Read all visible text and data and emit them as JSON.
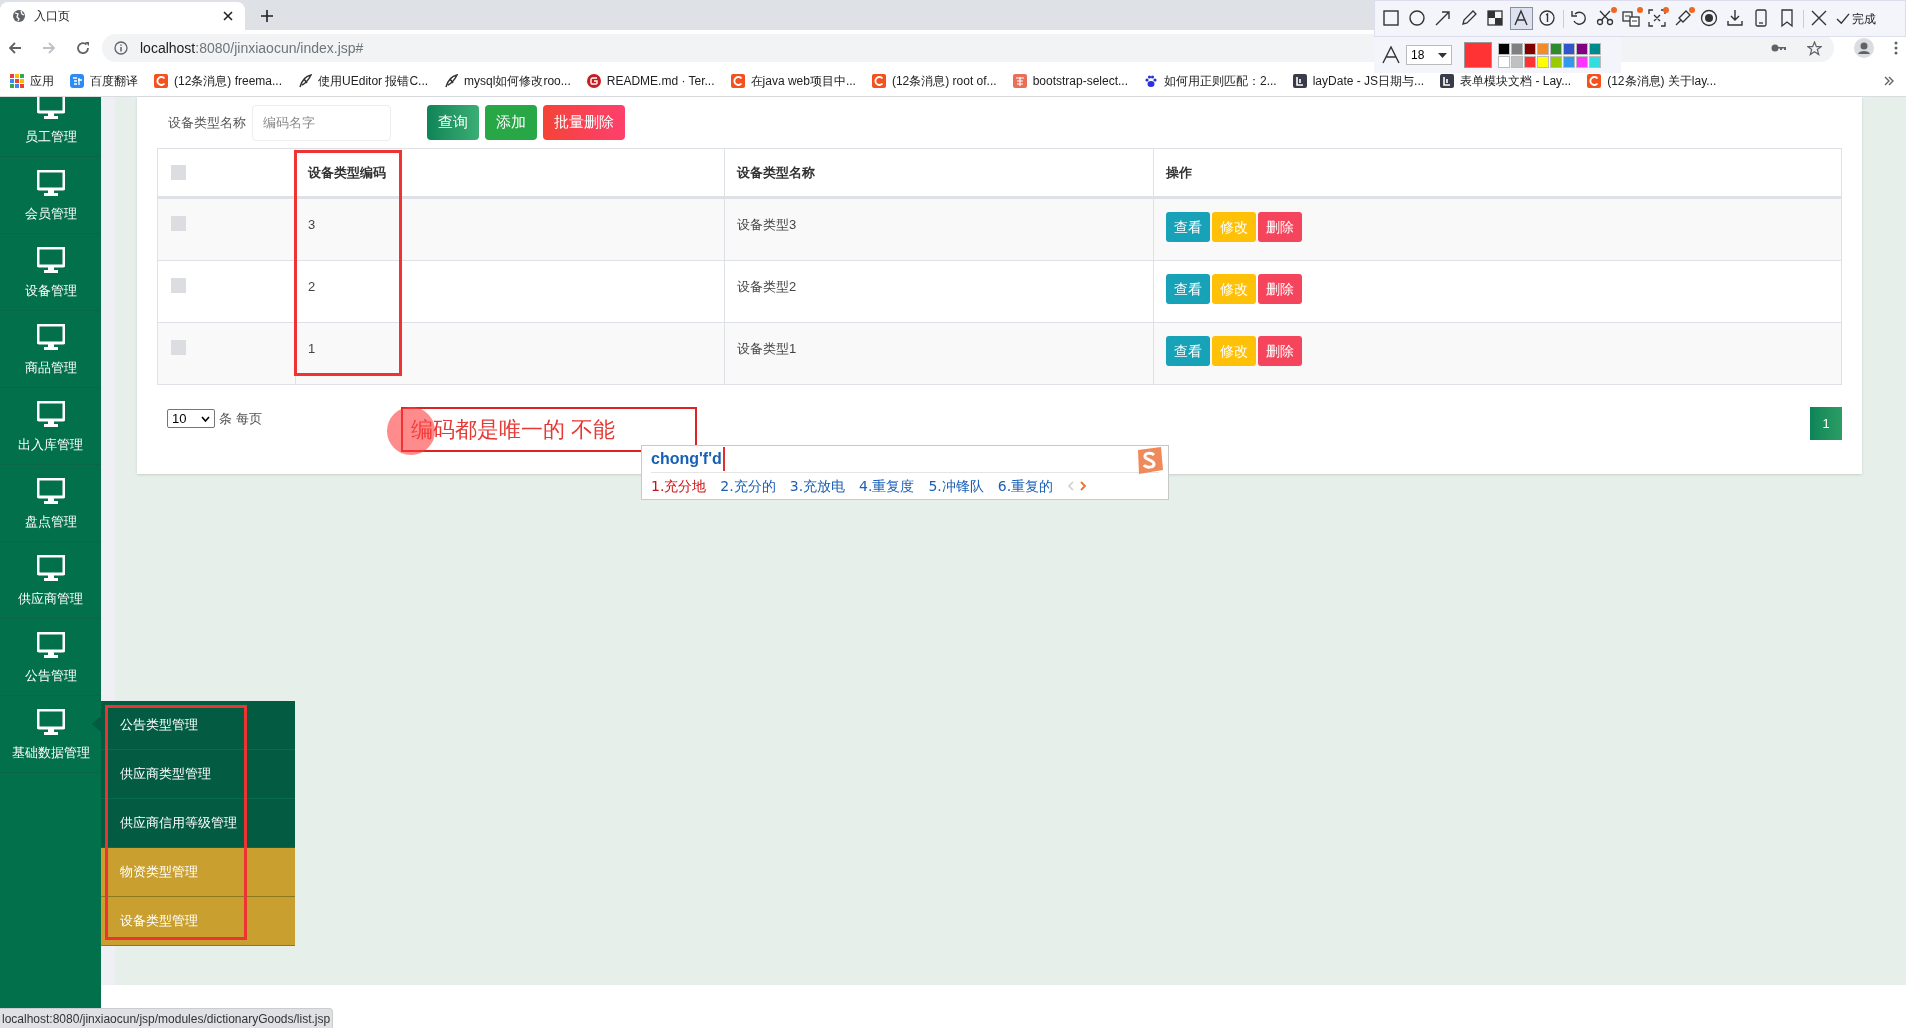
{
  "browser": {
    "tab": {
      "title": "入口页"
    },
    "url_host": "localhost",
    "url_rest": ":8080/jinxiaocun/index.jsp#",
    "bookmarks": [
      {
        "kind": "apps",
        "label": "应用"
      },
      {
        "kind": "translate",
        "label": "百度翻译"
      },
      {
        "kind": "csdn",
        "label": "(12条消息) freema..."
      },
      {
        "kind": "feather",
        "label": "使用UEditor 报错C..."
      },
      {
        "kind": "feather",
        "label": "mysql如何修改roo..."
      },
      {
        "kind": "gitee",
        "label": "README.md · Ter..."
      },
      {
        "kind": "csdn",
        "label": "在java web项目中..."
      },
      {
        "kind": "csdn",
        "label": "(12条消息) root of..."
      },
      {
        "kind": "jianshu",
        "label": "bootstrap-select..."
      },
      {
        "kind": "paw",
        "label": "如何用正则匹配：2..."
      },
      {
        "kind": "layui",
        "label": "layDate - JS日期与..."
      },
      {
        "kind": "layui",
        "label": "表单模块文档 - Lay..."
      },
      {
        "kind": "csdn",
        "label": "(12条消息) 关于lay..."
      }
    ]
  },
  "capture_toolbar": {
    "tool_groups": [
      [
        {
          "kind": "rect",
          "selected": false,
          "badge": false
        },
        {
          "kind": "ellipse",
          "selected": false,
          "badge": false
        },
        {
          "kind": "arrow",
          "selected": false,
          "badge": false
        },
        {
          "kind": "pencil",
          "selected": false,
          "badge": false
        },
        {
          "kind": "mosaic",
          "selected": false,
          "badge": false
        },
        {
          "kind": "text",
          "selected": true,
          "badge": false
        },
        {
          "kind": "number",
          "selected": false,
          "badge": false
        }
      ],
      [
        {
          "kind": "undo",
          "selected": false,
          "badge": false
        },
        {
          "kind": "scissors",
          "selected": false,
          "badge": true
        },
        {
          "kind": "translate",
          "selected": false,
          "badge": true
        },
        {
          "kind": "ocr",
          "selected": false,
          "badge": true
        },
        {
          "kind": "pin",
          "selected": false,
          "badge": true
        },
        {
          "kind": "record",
          "selected": false,
          "badge": false
        },
        {
          "kind": "download",
          "selected": false,
          "badge": false
        },
        {
          "kind": "phone",
          "selected": false,
          "badge": false
        },
        {
          "kind": "bookmark",
          "selected": false,
          "badge": false
        }
      ],
      [
        {
          "kind": "close",
          "selected": false,
          "badge": false
        }
      ]
    ],
    "done_label": "完成",
    "font_size": "18",
    "current": {
      "color": "#ff3333"
    },
    "palette": [
      {
        "color": "#000000"
      },
      {
        "color": "#808080"
      },
      {
        "color": "#800000"
      },
      {
        "color": "#f28c28"
      },
      {
        "color": "#2e8b2e"
      },
      {
        "color": "#3355cc"
      },
      {
        "color": "#800080"
      },
      {
        "color": "#008b8b"
      },
      {
        "color": "#ffffff"
      },
      {
        "color": "#c0c0c0"
      },
      {
        "color": "#ff3333"
      },
      {
        "color": "#ffff00"
      },
      {
        "color": "#99cc00"
      },
      {
        "color": "#3399ee"
      },
      {
        "color": "#ff33ff"
      },
      {
        "color": "#33dddd"
      }
    ]
  },
  "sidebar": {
    "items": [
      {
        "label": "员工管理"
      },
      {
        "label": "会员管理"
      },
      {
        "label": "设备管理"
      },
      {
        "label": "商品管理"
      },
      {
        "label": "出入库管理"
      },
      {
        "label": "盘点管理"
      },
      {
        "label": "供应商管理"
      },
      {
        "label": "公告管理"
      },
      {
        "label": "基础数据管理"
      }
    ],
    "submenu": [
      {
        "label": "公告类型管理",
        "highlighted": false
      },
      {
        "label": "供应商类型管理",
        "highlighted": false
      },
      {
        "label": "供应商信用等级管理",
        "highlighted": false
      },
      {
        "label": "物资类型管理",
        "highlighted": true
      },
      {
        "label": "设备类型管理",
        "highlighted": true
      }
    ]
  },
  "search": {
    "label": "设备类型名称",
    "placeholder": "编码名字",
    "buttons": [
      {
        "kind": "query",
        "label": "查询"
      },
      {
        "kind": "add",
        "label": "添加"
      },
      {
        "kind": "delete",
        "label": "批量删除"
      }
    ]
  },
  "table": {
    "select_all_checked": false,
    "columns": [
      "设备类型编码",
      "设备类型名称",
      "操作"
    ],
    "rows": [
      {
        "checked": false,
        "code": "3",
        "name": "设备类型3",
        "actions": [
          {
            "kind": "view",
            "label": "查看"
          },
          {
            "kind": "edit",
            "label": "修改"
          },
          {
            "kind": "delete",
            "label": "删除"
          }
        ]
      },
      {
        "checked": false,
        "code": "2",
        "name": "设备类型2",
        "actions": [
          {
            "kind": "view",
            "label": "查看"
          },
          {
            "kind": "edit",
            "label": "修改"
          },
          {
            "kind": "delete",
            "label": "删除"
          }
        ]
      },
      {
        "checked": false,
        "code": "1",
        "name": "设备类型1",
        "actions": [
          {
            "kind": "view",
            "label": "查看"
          },
          {
            "kind": "edit",
            "label": "修改"
          },
          {
            "kind": "delete",
            "label": "删除"
          }
        ]
      }
    ]
  },
  "pagination": {
    "page_size": "10",
    "page_size_label": "条 每页",
    "pages": [
      {
        "label": "1",
        "selected": true
      }
    ]
  },
  "annotation": {
    "note": "编码都是唯一的 不能"
  },
  "ime": {
    "input": "chong'f'd",
    "candidates": [
      {
        "label": "1.充分地",
        "selected": true
      },
      {
        "label": "2.充分的",
        "selected": false
      },
      {
        "label": "3.充放电",
        "selected": false
      },
      {
        "label": "4.重复度",
        "selected": false
      },
      {
        "label": "5.冲锋队",
        "selected": false
      },
      {
        "label": "6.重复的",
        "selected": false
      }
    ]
  },
  "status_bar": "localhost:8080/jinxiaocun/jsp/modules/dictionaryGoods/list.jsp"
}
